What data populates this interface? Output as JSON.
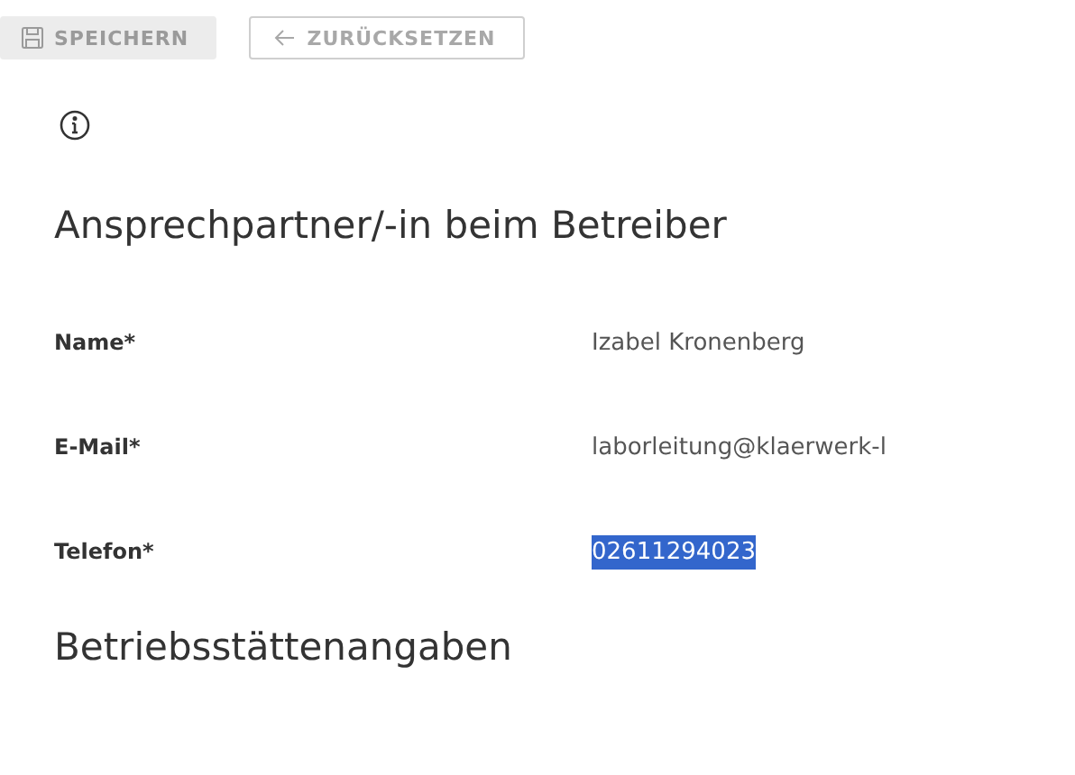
{
  "toolbar": {
    "buttons": [
      {
        "label": "SPEICHERN",
        "kind": "save",
        "disabled": true
      },
      {
        "label": "ZURÜCKSETZEN",
        "kind": "reset",
        "disabled": false
      }
    ]
  },
  "sections": [
    {
      "title": "Ansprechpartner/-in beim Betreiber",
      "fields": [
        {
          "label": "Name*",
          "value": "Izabel Kronenberg",
          "selected": false
        },
        {
          "label": "E-Mail*",
          "value": "laborleitung@klaerwerk-l",
          "selected": false
        },
        {
          "label": "Telefon*",
          "value": "02611294023",
          "selected": true
        }
      ]
    },
    {
      "title": "Betriebsstättenangaben"
    }
  ]
}
